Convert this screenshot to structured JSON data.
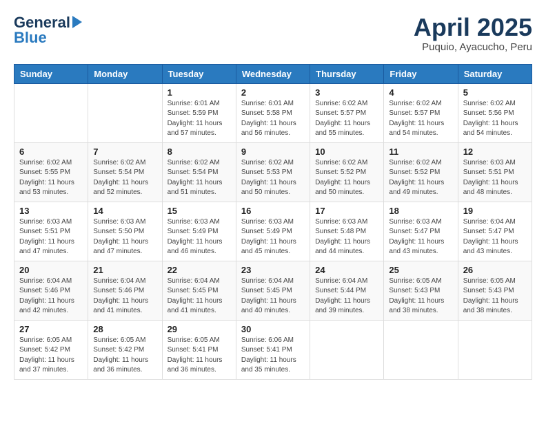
{
  "header": {
    "logo_general": "General",
    "logo_blue": "Blue",
    "month": "April 2025",
    "location": "Puquio, Ayacucho, Peru"
  },
  "calendar": {
    "days_of_week": [
      "Sunday",
      "Monday",
      "Tuesday",
      "Wednesday",
      "Thursday",
      "Friday",
      "Saturday"
    ],
    "weeks": [
      [
        {
          "day": "",
          "detail": ""
        },
        {
          "day": "",
          "detail": ""
        },
        {
          "day": "1",
          "detail": "Sunrise: 6:01 AM\nSunset: 5:59 PM\nDaylight: 11 hours and 57 minutes."
        },
        {
          "day": "2",
          "detail": "Sunrise: 6:01 AM\nSunset: 5:58 PM\nDaylight: 11 hours and 56 minutes."
        },
        {
          "day": "3",
          "detail": "Sunrise: 6:02 AM\nSunset: 5:57 PM\nDaylight: 11 hours and 55 minutes."
        },
        {
          "day": "4",
          "detail": "Sunrise: 6:02 AM\nSunset: 5:57 PM\nDaylight: 11 hours and 54 minutes."
        },
        {
          "day": "5",
          "detail": "Sunrise: 6:02 AM\nSunset: 5:56 PM\nDaylight: 11 hours and 54 minutes."
        }
      ],
      [
        {
          "day": "6",
          "detail": "Sunrise: 6:02 AM\nSunset: 5:55 PM\nDaylight: 11 hours and 53 minutes."
        },
        {
          "day": "7",
          "detail": "Sunrise: 6:02 AM\nSunset: 5:54 PM\nDaylight: 11 hours and 52 minutes."
        },
        {
          "day": "8",
          "detail": "Sunrise: 6:02 AM\nSunset: 5:54 PM\nDaylight: 11 hours and 51 minutes."
        },
        {
          "day": "9",
          "detail": "Sunrise: 6:02 AM\nSunset: 5:53 PM\nDaylight: 11 hours and 50 minutes."
        },
        {
          "day": "10",
          "detail": "Sunrise: 6:02 AM\nSunset: 5:52 PM\nDaylight: 11 hours and 50 minutes."
        },
        {
          "day": "11",
          "detail": "Sunrise: 6:02 AM\nSunset: 5:52 PM\nDaylight: 11 hours and 49 minutes."
        },
        {
          "day": "12",
          "detail": "Sunrise: 6:03 AM\nSunset: 5:51 PM\nDaylight: 11 hours and 48 minutes."
        }
      ],
      [
        {
          "day": "13",
          "detail": "Sunrise: 6:03 AM\nSunset: 5:51 PM\nDaylight: 11 hours and 47 minutes."
        },
        {
          "day": "14",
          "detail": "Sunrise: 6:03 AM\nSunset: 5:50 PM\nDaylight: 11 hours and 47 minutes."
        },
        {
          "day": "15",
          "detail": "Sunrise: 6:03 AM\nSunset: 5:49 PM\nDaylight: 11 hours and 46 minutes."
        },
        {
          "day": "16",
          "detail": "Sunrise: 6:03 AM\nSunset: 5:49 PM\nDaylight: 11 hours and 45 minutes."
        },
        {
          "day": "17",
          "detail": "Sunrise: 6:03 AM\nSunset: 5:48 PM\nDaylight: 11 hours and 44 minutes."
        },
        {
          "day": "18",
          "detail": "Sunrise: 6:03 AM\nSunset: 5:47 PM\nDaylight: 11 hours and 43 minutes."
        },
        {
          "day": "19",
          "detail": "Sunrise: 6:04 AM\nSunset: 5:47 PM\nDaylight: 11 hours and 43 minutes."
        }
      ],
      [
        {
          "day": "20",
          "detail": "Sunrise: 6:04 AM\nSunset: 5:46 PM\nDaylight: 11 hours and 42 minutes."
        },
        {
          "day": "21",
          "detail": "Sunrise: 6:04 AM\nSunset: 5:46 PM\nDaylight: 11 hours and 41 minutes."
        },
        {
          "day": "22",
          "detail": "Sunrise: 6:04 AM\nSunset: 5:45 PM\nDaylight: 11 hours and 41 minutes."
        },
        {
          "day": "23",
          "detail": "Sunrise: 6:04 AM\nSunset: 5:45 PM\nDaylight: 11 hours and 40 minutes."
        },
        {
          "day": "24",
          "detail": "Sunrise: 6:04 AM\nSunset: 5:44 PM\nDaylight: 11 hours and 39 minutes."
        },
        {
          "day": "25",
          "detail": "Sunrise: 6:05 AM\nSunset: 5:43 PM\nDaylight: 11 hours and 38 minutes."
        },
        {
          "day": "26",
          "detail": "Sunrise: 6:05 AM\nSunset: 5:43 PM\nDaylight: 11 hours and 38 minutes."
        }
      ],
      [
        {
          "day": "27",
          "detail": "Sunrise: 6:05 AM\nSunset: 5:42 PM\nDaylight: 11 hours and 37 minutes."
        },
        {
          "day": "28",
          "detail": "Sunrise: 6:05 AM\nSunset: 5:42 PM\nDaylight: 11 hours and 36 minutes."
        },
        {
          "day": "29",
          "detail": "Sunrise: 6:05 AM\nSunset: 5:41 PM\nDaylight: 11 hours and 36 minutes."
        },
        {
          "day": "30",
          "detail": "Sunrise: 6:06 AM\nSunset: 5:41 PM\nDaylight: 11 hours and 35 minutes."
        },
        {
          "day": "",
          "detail": ""
        },
        {
          "day": "",
          "detail": ""
        },
        {
          "day": "",
          "detail": ""
        }
      ]
    ]
  }
}
